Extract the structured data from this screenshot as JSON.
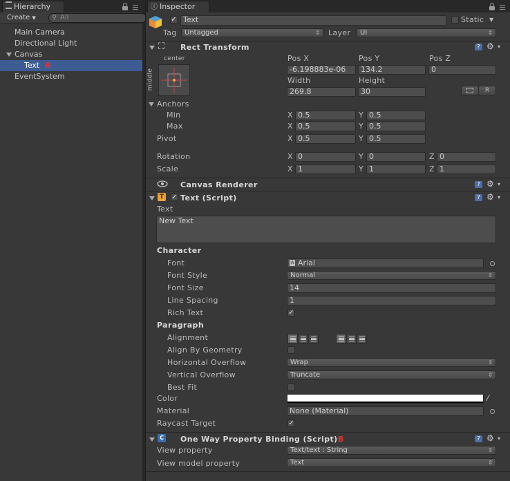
{
  "hierarchy": {
    "tab_label": "Hierarchy",
    "create_label": "Create",
    "search_placeholder": "All",
    "items": [
      {
        "label": "Main Camera"
      },
      {
        "label": "Directional Light"
      },
      {
        "label": "Canvas"
      },
      {
        "label": "Text"
      },
      {
        "label": "EventSystem"
      }
    ],
    "annotation_a": "A"
  },
  "inspector": {
    "tab_label": "Inspector",
    "object": {
      "name": "Text",
      "static_label": "Static",
      "tag_label": "Tag",
      "tag_value": "Untagged",
      "layer_label": "Layer",
      "layer_value": "UI"
    },
    "rect_transform": {
      "title": "Rect Transform",
      "anchor_h": "center",
      "anchor_v": "middle",
      "pos_x_label": "Pos X",
      "pos_y_label": "Pos Y",
      "pos_z_label": "Pos Z",
      "pos_x": "-6.198883e-06",
      "pos_y": "134.2",
      "pos_z": "0",
      "width_label": "Width",
      "height_label": "Height",
      "width": "269.8",
      "height": "30",
      "r_button": "R",
      "anchors_label": "Anchors",
      "min_label": "Min",
      "max_label": "Max",
      "pivot_label": "Pivot",
      "x": "X",
      "y": "Y",
      "z": "Z",
      "min_x": "0.5",
      "min_y": "0.5",
      "max_x": "0.5",
      "max_y": "0.5",
      "pivot_x": "0.5",
      "pivot_y": "0.5",
      "rotation_label": "Rotation",
      "rot_x": "0",
      "rot_y": "0",
      "rot_z": "0",
      "scale_label": "Scale",
      "scale_x": "1",
      "scale_y": "1",
      "scale_z": "1"
    },
    "canvas_renderer": {
      "title": "Canvas Renderer"
    },
    "text_script": {
      "title": "Text (Script)",
      "text_label": "Text",
      "text_value": "New Text",
      "character_label": "Character",
      "font_label": "Font",
      "font_value": "Arial",
      "font_style_label": "Font Style",
      "font_style_value": "Normal",
      "font_size_label": "Font Size",
      "font_size_value": "14",
      "line_spacing_label": "Line Spacing",
      "line_spacing_value": "1",
      "rich_text_label": "Rich Text",
      "paragraph_label": "Paragraph",
      "alignment_label": "Alignment",
      "align_by_geometry_label": "Align By Geometry",
      "horizontal_overflow_label": "Horizontal Overflow",
      "horizontal_overflow_value": "Wrap",
      "vertical_overflow_label": "Vertical Overflow",
      "vertical_overflow_value": "Truncate",
      "best_fit_label": "Best Fit",
      "color_label": "Color",
      "color_value": "#ffffff",
      "material_label": "Material",
      "material_value": "None (Material)",
      "raycast_label": "Raycast Target"
    },
    "binding_script": {
      "title": "One Way Property Binding (Script)",
      "annotation_b": "B",
      "view_property_label": "View property",
      "view_property_value": "Text/text : String",
      "view_model_property_label": "View model property",
      "view_model_property_value": "Text"
    }
  },
  "colors": {
    "selection": "#3d5c94",
    "annotation": "#e8322c"
  }
}
